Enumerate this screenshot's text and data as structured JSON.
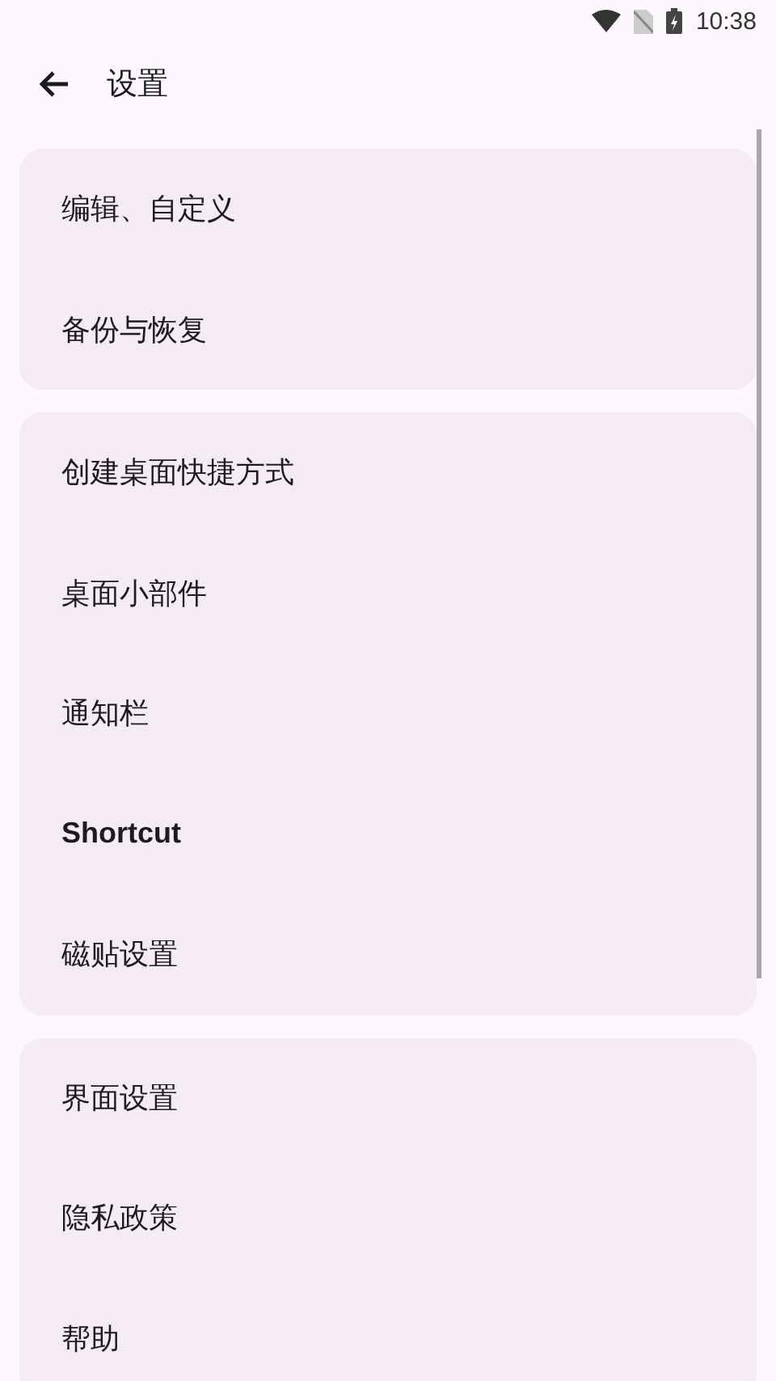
{
  "status_bar": {
    "time": "10:38"
  },
  "header": {
    "title": "设置"
  },
  "groups": [
    {
      "items": [
        {
          "label": "编辑、自定义",
          "bold": false
        },
        {
          "label": "备份与恢复",
          "bold": false
        }
      ]
    },
    {
      "items": [
        {
          "label": "创建桌面快捷方式",
          "bold": false
        },
        {
          "label": "桌面小部件",
          "bold": false
        },
        {
          "label": "通知栏",
          "bold": false
        },
        {
          "label": "Shortcut",
          "bold": true
        },
        {
          "label": "磁贴设置",
          "bold": false
        }
      ]
    },
    {
      "items": [
        {
          "label": "界面设置",
          "bold": false
        },
        {
          "label": "隐私政策",
          "bold": false
        },
        {
          "label": "帮助",
          "bold": false
        }
      ]
    }
  ]
}
